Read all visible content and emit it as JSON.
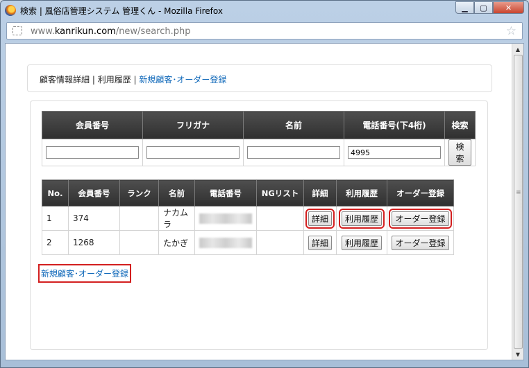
{
  "window": {
    "title": "検索 | 風俗店管理システム 管理くん - Mozilla Firefox"
  },
  "url": {
    "prefix": "www.",
    "host": "kanrikun.com",
    "path": "/new/search.php"
  },
  "nav": {
    "item1": "顧客情報詳細",
    "sep1": " | ",
    "item2": "利用履歴",
    "sep2": " | ",
    "item3": "新規顧客･オーダー登録"
  },
  "search": {
    "headers": [
      "会員番号",
      "フリガナ",
      "名前",
      "電話番号(下4桁)",
      "検索"
    ],
    "values": [
      "",
      "",
      "",
      "4995"
    ],
    "button": "検索"
  },
  "results": {
    "headers": [
      "No.",
      "会員番号",
      "ランク",
      "名前",
      "電話番号",
      "NGリスト",
      "詳細",
      "利用履歴",
      "オーダー登録"
    ],
    "rows": [
      {
        "no": "1",
        "member": "374",
        "rank": "",
        "name": "ナカムラ",
        "ng": "",
        "detail": "詳細",
        "history": "利用履歴",
        "order": "オーダー登録"
      },
      {
        "no": "2",
        "member": "1268",
        "rank": "",
        "name": "たかぎ",
        "ng": "",
        "detail": "詳細",
        "history": "利用履歴",
        "order": "オーダー登録"
      }
    ]
  },
  "bottom_link": "新規顧客･オーダー登録",
  "colors": {
    "link": "#0a65b8",
    "highlight": "#d31f1f",
    "header_bg": "#3a3a3a"
  }
}
